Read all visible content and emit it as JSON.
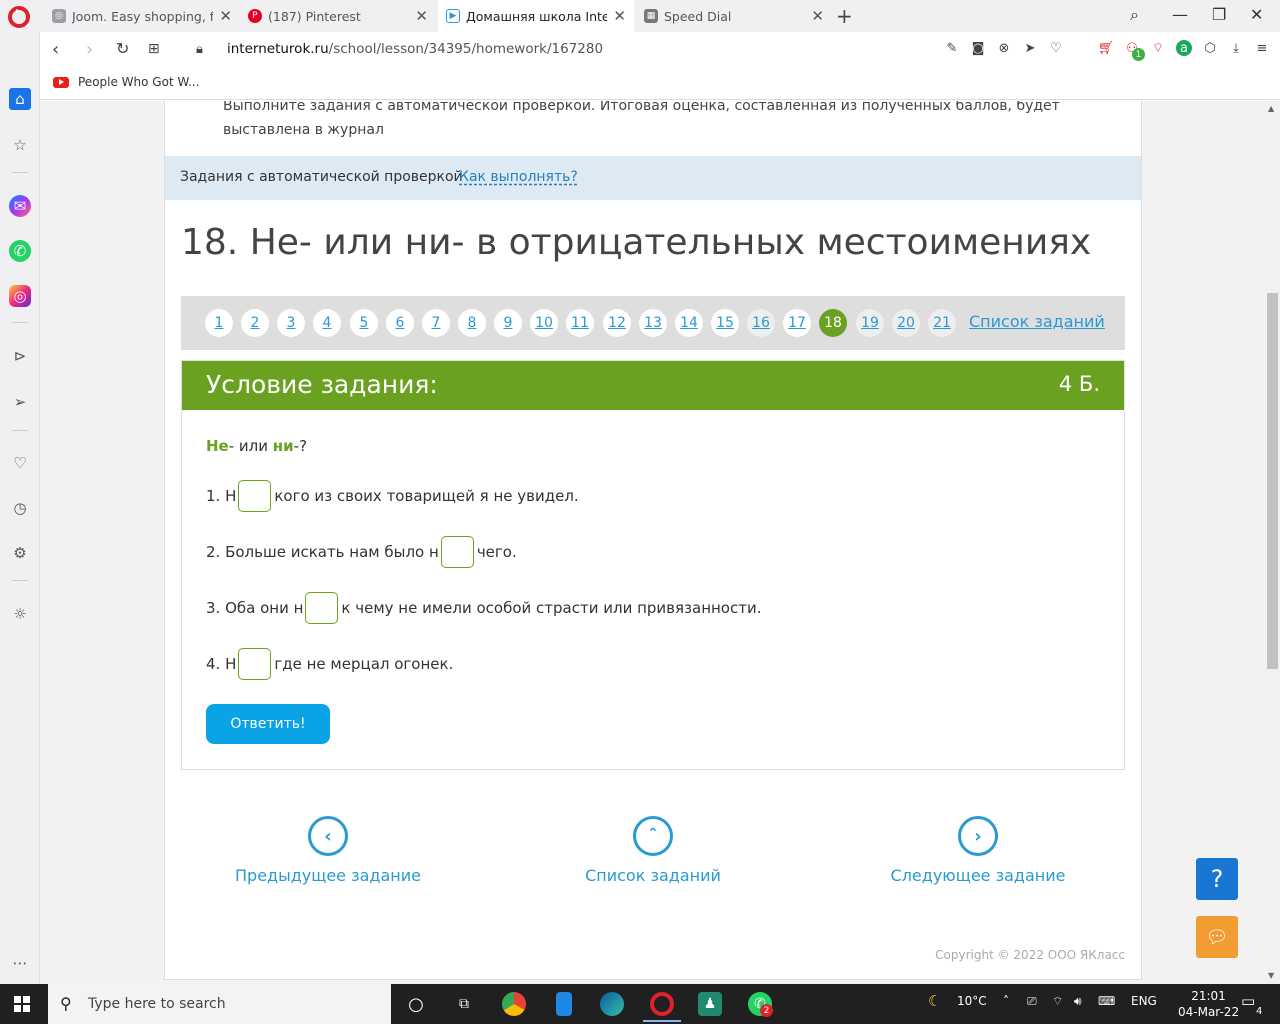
{
  "browser": {
    "tabs": [
      {
        "title": "Joom. Easy shopping, fast a",
        "close": "✕"
      },
      {
        "title": "(187) Pinterest",
        "close": "✕"
      },
      {
        "title": "Домашняя школа Internet",
        "close": "✕"
      },
      {
        "title": "Speed Dial",
        "close": "✕"
      }
    ],
    "new_tab": "+",
    "url_host": "interneturok.ru",
    "url_path": "/school/lesson/34395/homework/167280",
    "bookmark": "People Who Got W...",
    "badge_count": "1"
  },
  "page": {
    "intro_text": "Выполните задания с автоматической проверкой. Итоговая оценка, составленная из полученных баллов, будет выставлена в журнал",
    "auto_label": "Задания с автоматической проверкой",
    "how_link": "Как выполнять?",
    "heading": "18. Не- или ни- в отрицательных местоимениях",
    "pager": {
      "pages": [
        "1",
        "2",
        "3",
        "4",
        "5",
        "6",
        "7",
        "8",
        "9",
        "10",
        "11",
        "12",
        "13",
        "14",
        "15",
        "16",
        "17",
        "18",
        "19",
        "20",
        "21"
      ],
      "active": "18",
      "all_link": "Список заданий"
    },
    "task": {
      "title": "Условие задания:",
      "points": "4 Б.",
      "question_a": "Не",
      "question_mid": "- или ",
      "question_b": "ни",
      "question_end": "-?",
      "sentences": [
        {
          "before": "1. Н",
          "after": "кого из своих товарищей я не увидел."
        },
        {
          "before": "2. Больше искать нам было н",
          "after": "чего."
        },
        {
          "before": "3. Оба они н",
          "after": " к чему не имели особой страсти или привязанности."
        },
        {
          "before": "4. Н",
          "after": "где не мерцал огонек."
        }
      ],
      "answer_button": "Ответить!"
    },
    "nav": {
      "prev": "Предыдущее задание",
      "list": "Список заданий",
      "next": "Следующее задание"
    },
    "copyright": "Copyright © 2022 ООО ЯКласс",
    "help": "?"
  },
  "taskbar": {
    "search_placeholder": "Type here to search",
    "temperature": "10°C",
    "lang": "ENG",
    "time": "21:01",
    "date": "04-Mar-22",
    "notif_count": "4",
    "whatsapp_badge": "2"
  },
  "colors": {
    "accent_green": "#6aa120",
    "link_blue": "#2a9ad0",
    "button_blue": "#0aa3e5"
  }
}
